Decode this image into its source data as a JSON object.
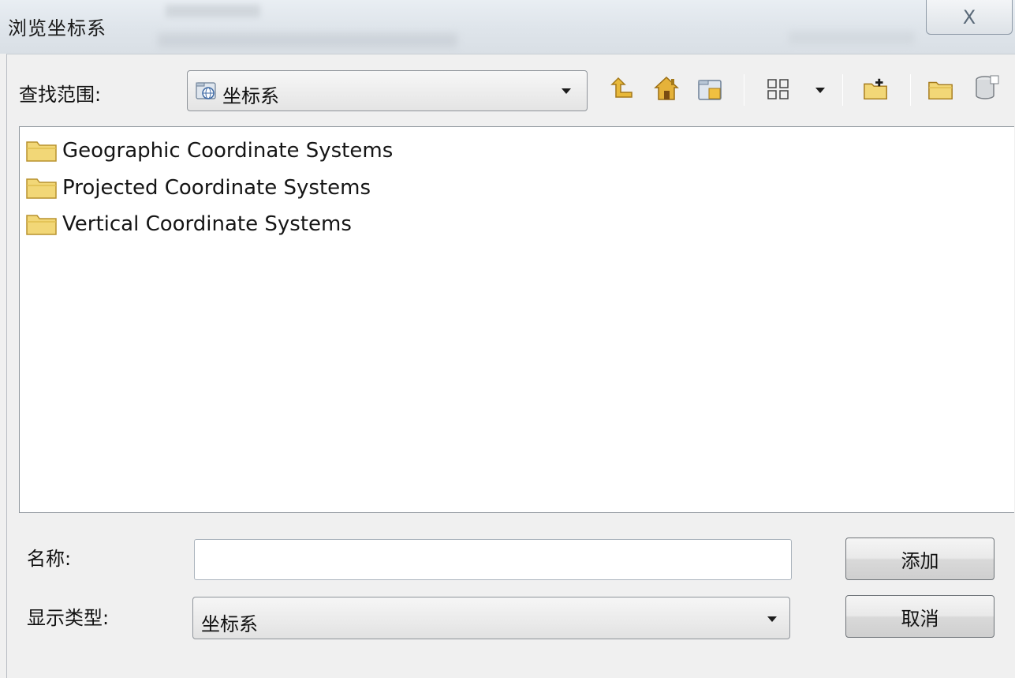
{
  "window": {
    "title": "浏览坐标系",
    "close_glyph": "X"
  },
  "lookin": {
    "label": "查找范围:",
    "value": "坐标系"
  },
  "toolbar": {
    "icons": [
      "up-one-level-icon",
      "home-icon",
      "connect-folder-icon",
      "view-toggle-icon",
      "view-dropdown-icon",
      "new-folder-icon",
      "folder-icon",
      "database-icon"
    ]
  },
  "files": [
    {
      "label": "Geographic Coordinate Systems",
      "icon": "folder-icon"
    },
    {
      "label": "Projected Coordinate Systems",
      "icon": "folder-icon"
    },
    {
      "label": "Vertical Coordinate Systems",
      "icon": "folder-icon"
    }
  ],
  "name_field": {
    "label": "名称:",
    "value": ""
  },
  "type_field": {
    "label": "显示类型:",
    "value": "坐标系"
  },
  "buttons": {
    "add": "添加",
    "cancel": "取消"
  },
  "colors": {
    "folder": "#f2d777",
    "folder_dark": "#c9a43b",
    "dialog_bg": "#f0f0f0"
  }
}
